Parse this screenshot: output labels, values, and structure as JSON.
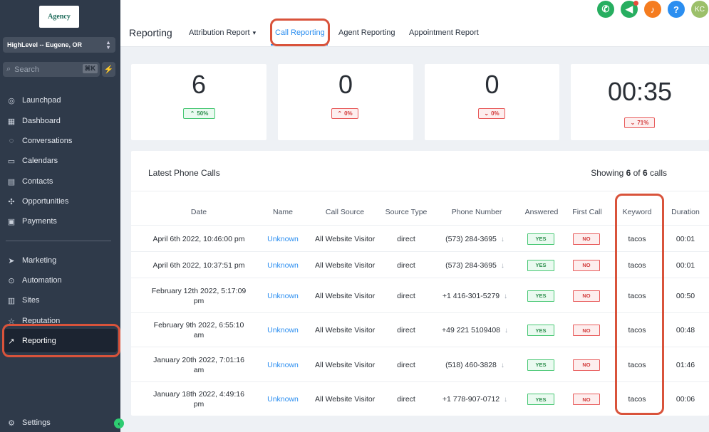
{
  "sidebar": {
    "logo_text": "Agency",
    "location": "HighLevel -- Eugene, OR",
    "search_placeholder": "Search",
    "search_shortcut": "⌘K",
    "items": [
      {
        "label": "Launchpad",
        "icon": "rocket-icon"
      },
      {
        "label": "Dashboard",
        "icon": "dashboard-icon"
      },
      {
        "label": "Conversations",
        "icon": "chat-icon"
      },
      {
        "label": "Calendars",
        "icon": "calendar-icon"
      },
      {
        "label": "Contacts",
        "icon": "contacts-icon"
      },
      {
        "label": "Opportunities",
        "icon": "funnel-icon"
      },
      {
        "label": "Payments",
        "icon": "payments-icon"
      },
      {
        "label": "Marketing",
        "icon": "send-icon"
      },
      {
        "label": "Automation",
        "icon": "automation-icon"
      },
      {
        "label": "Sites",
        "icon": "sites-icon"
      },
      {
        "label": "Reputation",
        "icon": "star-icon"
      },
      {
        "label": "Reporting",
        "icon": "trend-icon"
      },
      {
        "label": "Settings",
        "icon": "gear-icon"
      }
    ]
  },
  "header": {
    "title": "Reporting",
    "tabs": [
      {
        "label": "Attribution Report"
      },
      {
        "label": "Call Reporting"
      },
      {
        "label": "Agent Reporting"
      },
      {
        "label": "Appointment Report"
      }
    ],
    "avatar": "KC",
    "accent": "#2b8ef0"
  },
  "stats": [
    {
      "value": "6",
      "change": "50%",
      "direction": "up"
    },
    {
      "value": "0",
      "change": "0%",
      "direction": "up-red"
    },
    {
      "value": "0",
      "change": "0%",
      "direction": "down"
    },
    {
      "value": "00:35",
      "change": "71%",
      "direction": "down"
    }
  ],
  "table": {
    "title": "Latest Phone Calls",
    "count_prefix": "Showing ",
    "count_shown": "6",
    "count_mid": " of ",
    "count_total": "6",
    "count_suffix": " calls",
    "columns": [
      "Date",
      "Name",
      "Call Source",
      "Source Type",
      "Phone Number",
      "Answered",
      "First Call",
      "Keyword",
      "Duration"
    ],
    "rows": [
      {
        "date1": "April 6th 2022, 10:46:00 pm",
        "date2": "",
        "name": "Unknown",
        "source": "All Website Visitor",
        "type": "direct",
        "phone": "(573) 284-3695",
        "answered": "YES",
        "first": "NO",
        "keyword": "tacos",
        "duration": "00:01"
      },
      {
        "date1": "April 6th 2022, 10:37:51 pm",
        "date2": "",
        "name": "Unknown",
        "source": "All Website Visitor",
        "type": "direct",
        "phone": "(573) 284-3695",
        "answered": "YES",
        "first": "NO",
        "keyword": "tacos",
        "duration": "00:01"
      },
      {
        "date1": "February 12th 2022, 5:17:09",
        "date2": "pm",
        "name": "Unknown",
        "source": "All Website Visitor",
        "type": "direct",
        "phone": "+1 416-301-5279",
        "answered": "YES",
        "first": "NO",
        "keyword": "tacos",
        "duration": "00:50"
      },
      {
        "date1": "February 9th 2022, 6:55:10",
        "date2": "am",
        "name": "Unknown",
        "source": "All Website Visitor",
        "type": "direct",
        "phone": "+49 221 5109408",
        "answered": "YES",
        "first": "NO",
        "keyword": "tacos",
        "duration": "00:48"
      },
      {
        "date1": "January 20th 2022, 7:01:16",
        "date2": "am",
        "name": "Unknown",
        "source": "All Website Visitor",
        "type": "direct",
        "phone": "(518) 460-3828",
        "answered": "YES",
        "first": "NO",
        "keyword": "tacos",
        "duration": "01:46"
      },
      {
        "date1": "January 18th 2022, 4:49:16",
        "date2": "pm",
        "name": "Unknown",
        "source": "All Website Visitor",
        "type": "direct",
        "phone": "+1 778-907-0712",
        "answered": "YES",
        "first": "NO",
        "keyword": "tacos",
        "duration": "00:06"
      }
    ]
  }
}
